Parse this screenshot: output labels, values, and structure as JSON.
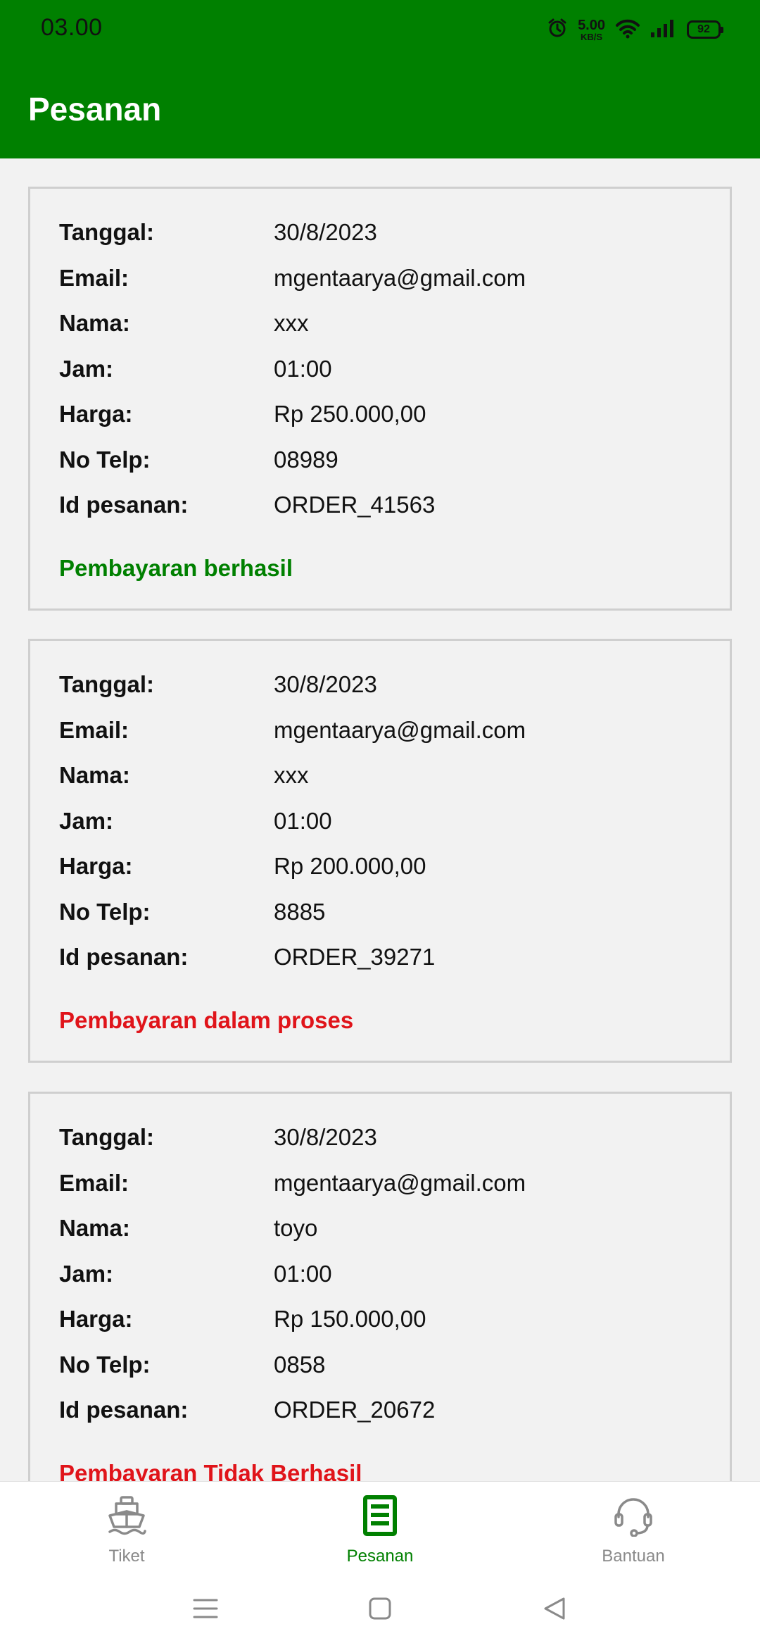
{
  "status_bar": {
    "time": "03.00",
    "net_speed_value": "5.00",
    "net_speed_unit": "KB/S",
    "battery": "92"
  },
  "header": {
    "title": "Pesanan"
  },
  "colors": {
    "primary": "#008000",
    "error": "#e0141a",
    "inactive": "#8a8a8a"
  },
  "orders": [
    {
      "rows": [
        {
          "label": "Tanggal:",
          "value": "30/8/2023"
        },
        {
          "label": "Email:",
          "value": "mgentaarya@gmail.com"
        },
        {
          "label": "Nama:",
          "value": "xxx"
        },
        {
          "label": "Jam:",
          "value": "01:00"
        },
        {
          "label": "Harga:",
          "value": "Rp 250.000,00"
        },
        {
          "label": "No Telp:",
          "value": "08989"
        },
        {
          "label": "Id pesanan:",
          "value": "ORDER_41563"
        }
      ],
      "status": "Pembayaran berhasil",
      "status_color": "#008000"
    },
    {
      "rows": [
        {
          "label": "Tanggal:",
          "value": "30/8/2023"
        },
        {
          "label": "Email:",
          "value": "mgentaarya@gmail.com"
        },
        {
          "label": "Nama:",
          "value": "xxx"
        },
        {
          "label": "Jam:",
          "value": "01:00"
        },
        {
          "label": "Harga:",
          "value": "Rp 200.000,00"
        },
        {
          "label": "No Telp:",
          "value": "8885"
        },
        {
          "label": "Id pesanan:",
          "value": "ORDER_39271"
        }
      ],
      "status": "Pembayaran dalam proses",
      "status_color": "#e0141a"
    },
    {
      "rows": [
        {
          "label": "Tanggal:",
          "value": "30/8/2023"
        },
        {
          "label": "Email:",
          "value": "mgentaarya@gmail.com"
        },
        {
          "label": "Nama:",
          "value": "toyo"
        },
        {
          "label": "Jam:",
          "value": "01:00"
        },
        {
          "label": "Harga:",
          "value": "Rp 150.000,00"
        },
        {
          "label": "No Telp:",
          "value": "0858"
        },
        {
          "label": "Id pesanan:",
          "value": "ORDER_20672"
        }
      ],
      "status": "Pembayaran Tidak Berhasil",
      "status_color": "#e0141a"
    }
  ],
  "bottom_nav": {
    "items": [
      {
        "label": "Tiket",
        "icon": "ship-icon",
        "active": false
      },
      {
        "label": "Pesanan",
        "icon": "document-list-icon",
        "active": true
      },
      {
        "label": "Bantuan",
        "icon": "headset-icon",
        "active": false
      }
    ]
  },
  "system_nav": [
    "menu-icon",
    "home-icon",
    "back-icon"
  ]
}
